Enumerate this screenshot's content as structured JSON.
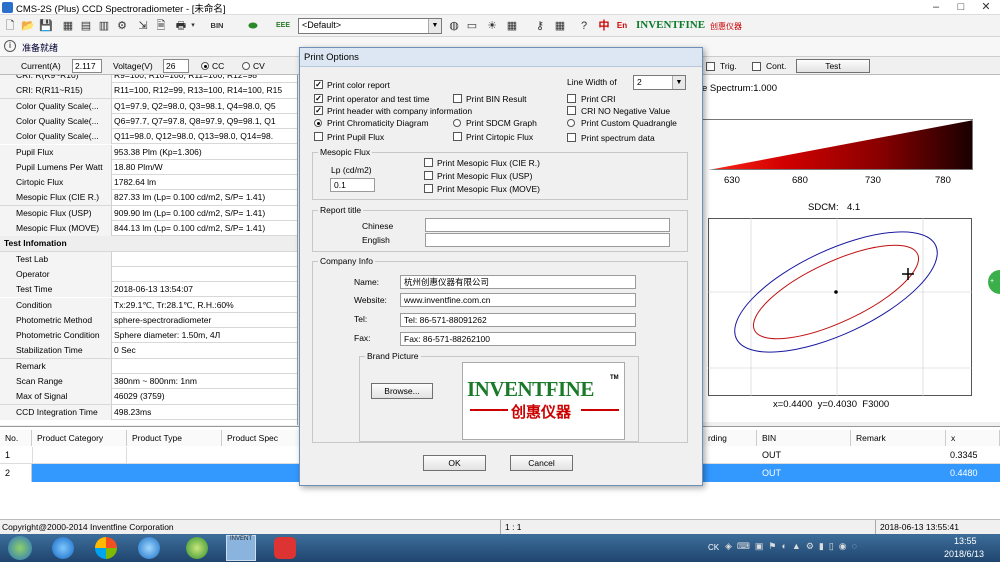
{
  "window": {
    "title": "CMS-2S (Plus) CCD Spectroradiometer - [未命名]",
    "status_text": "准备就绪"
  },
  "toolbar": {
    "profile_select": "<Default>",
    "bin_label": "BIN",
    "eee_label": "EEE",
    "zh_label": "中",
    "en_label": "En",
    "brand": "INVENTFINE",
    "brand_cn": "创惠仪器"
  },
  "controls": {
    "current_label": "Current(A)",
    "current_value": "2.117",
    "voltage_label": "Voltage(V)",
    "voltage_value": "26",
    "cc_label": "CC",
    "cv_label": "CV",
    "trig_label": "Trig.",
    "cont_label": "Cont.",
    "test_label": "Test"
  },
  "grid": {
    "rows": [
      {
        "k": "CRI: R(R9~R10)",
        "v": "R9=100, R10=100, R11=100, R12=98"
      },
      {
        "k": "CRI: R(R11~R15)",
        "v": "R11=100, R12=99, R13=100, R14=100, R15"
      },
      {
        "k": "Color Quality Scale(...",
        "v": "Q1=97.9, Q2=98.0, Q3=98.1, Q4=98.0, Q5"
      },
      {
        "k": "Color Quality Scale(...",
        "v": "Q6=97.7, Q7=97.8, Q8=97.9, Q9=98.1, Q1"
      },
      {
        "k": "Color Quality Scale(...",
        "v": "Q11=98.0, Q12=98.0, Q13=98.0, Q14=98."
      },
      {
        "k": "Pupil Flux",
        "v": "953.38 Plm (Kp=1.306)"
      },
      {
        "k": "Pupil Lumens Per Watt",
        "v": "18.80 Plm/W"
      },
      {
        "k": "Cirtopic Flux",
        "v": "1782.64 lm"
      },
      {
        "k": "Mesopic Flux (CIE R.)",
        "v": "827.33 lm (Lp= 0.100 cd/m2, S/P= 1.41)"
      },
      {
        "k": "Mesopic Flux (USP)",
        "v": "909.90 lm (Lp= 0.100 cd/m2, S/P= 1.41)"
      },
      {
        "k": "Mesopic Flux (MOVE)",
        "v": "844.13 lm (Lp= 0.100 cd/m2, S/P= 1.41)"
      },
      {
        "header": "Test Infomation"
      },
      {
        "k": "Test Lab",
        "v": ""
      },
      {
        "k": "Operator",
        "v": ""
      },
      {
        "k": "Test Time",
        "v": "2018-06-13 13:54:07"
      },
      {
        "k": "Condition",
        "v": "Tx:29.1℃, Tr:28.1℃, R.H.:60%"
      },
      {
        "k": "Photometric Method",
        "v": "sphere-spectroradiometer"
      },
      {
        "k": "Photometric Condition",
        "v": "Sphere diameter: 1.50m, 4Л"
      },
      {
        "k": "Stabilization Time",
        "v": "0 Sec"
      },
      {
        "k": "Remark",
        "v": ""
      },
      {
        "k": "Scan Range",
        "v": "380nm ~ 800nm: 1nm"
      },
      {
        "k": "Max of Signal",
        "v": "46029 (3759)"
      },
      {
        "k": "CCD Integration Time",
        "v": "498.23ms"
      }
    ]
  },
  "spectrum": {
    "title": "e Spectrum:1.000",
    "ticks": [
      "630",
      "680",
      "730",
      "780"
    ]
  },
  "cie": {
    "sdcm_label": "SDCM:",
    "sdcm_value": "4.1",
    "coords": "x=0.4400  y=0.4030  F3000"
  },
  "bottom_table": {
    "headers": [
      "No.",
      "Product Category",
      "Product Type",
      "Product Spec",
      "rding",
      "BIN",
      "Remark",
      "x"
    ],
    "rows": [
      {
        "no": "1",
        "bin": "OUT",
        "x": "0.3345"
      },
      {
        "no": "2",
        "bin": "OUT",
        "x": "0.4480"
      }
    ]
  },
  "statusbar": {
    "copyright": "Copyright@2000-2014 Inventfine Corporation",
    "ratio": "1 : 1",
    "datetime": "2018-06-13 13:55:41"
  },
  "taskbar": {
    "time": "13:55",
    "date": "2018/6/13",
    "lang": "CK",
    "app_label": "INVENT"
  },
  "dialog": {
    "title": "Print Options",
    "opts_left": [
      {
        "label": "Print color report",
        "checked": true
      },
      {
        "label": "Print operator and test time",
        "checked": true
      },
      {
        "label": "Print header with company information",
        "checked": true
      },
      {
        "label": "Print Chromaticity Diagram",
        "checked": true,
        "radio": true
      },
      {
        "label": "Print Pupil Flux",
        "checked": false
      }
    ],
    "opt_bin": "Print BIN Result",
    "opt_sdcm": "Print SDCM Graph",
    "opt_cirtopic": "Print Cirtopic Flux",
    "line_width_label": "Line Width of",
    "line_width_value": "2",
    "opts_right": [
      "Print CRI",
      "CRI NO Negative Value",
      "Print Custom Quadrangle",
      "Print spectrum data"
    ],
    "mesopic": {
      "title": "Mesopic Flux",
      "lp_label": "Lp (cd/m2)",
      "lp_value": "0.1",
      "opts": [
        "Print Mesopic Flux (CIE R.)",
        "Print Mesopic Flux (USP)",
        "Print Mesopic Flux (MOVE)"
      ]
    },
    "report": {
      "title": "Report title",
      "chinese_label": "Chinese",
      "english_label": "English"
    },
    "company": {
      "title": "Company Info",
      "name_label": "Name:",
      "name_value": "杭州创惠仪器有限公司",
      "website_label": "Website:",
      "website_value": "www.inventfine.com.cn",
      "tel_label": "Tel:",
      "tel_value": "Tel: 86-571-88091262",
      "fax_label": "Fax:",
      "fax_value": "Fax: 86-571-88262100"
    },
    "brand": {
      "title": "Brand Picture",
      "browse_label": "Browse...",
      "logo_text": "INVENTFINE",
      "logo_tm": "TM",
      "logo_cn": "创惠仪器"
    },
    "ok_label": "OK",
    "cancel_label": "Cancel"
  }
}
